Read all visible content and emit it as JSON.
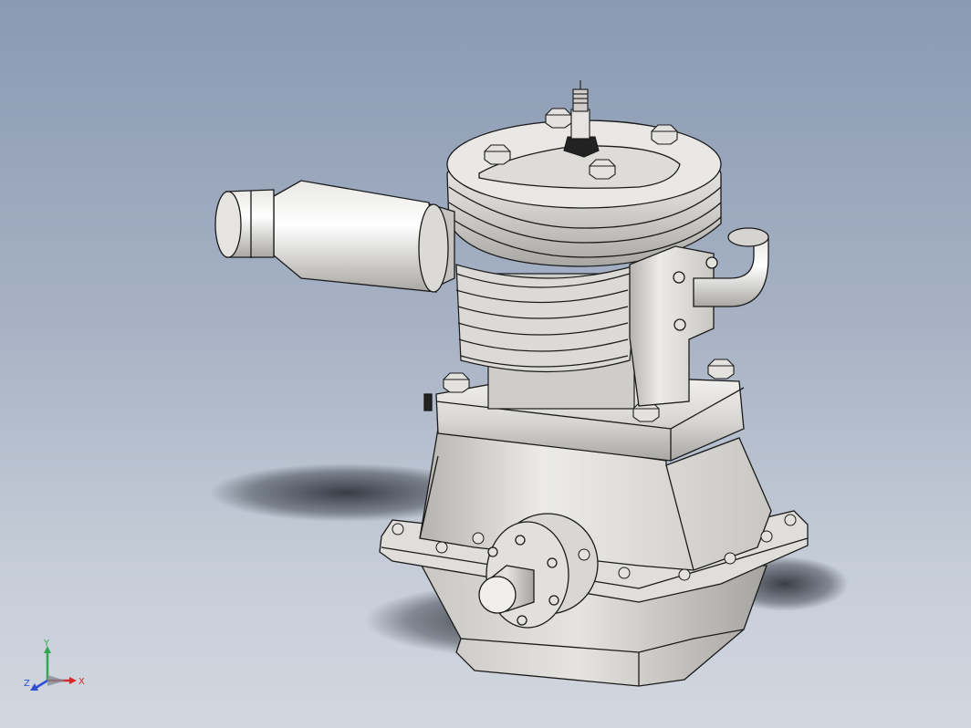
{
  "viewport": {
    "background_top": "#8a9ab3",
    "background_bottom": "#d2d7de"
  },
  "model": {
    "body_color": "#e2e0dc",
    "shade_color": "#b9b7b3",
    "edge_color": "#1a1a1a"
  },
  "triad": {
    "x_label": "X",
    "y_label": "Y",
    "z_label": "Z",
    "x_color": "#d42a2a",
    "y_color": "#2fa84f",
    "z_color": "#2f4fd4"
  }
}
